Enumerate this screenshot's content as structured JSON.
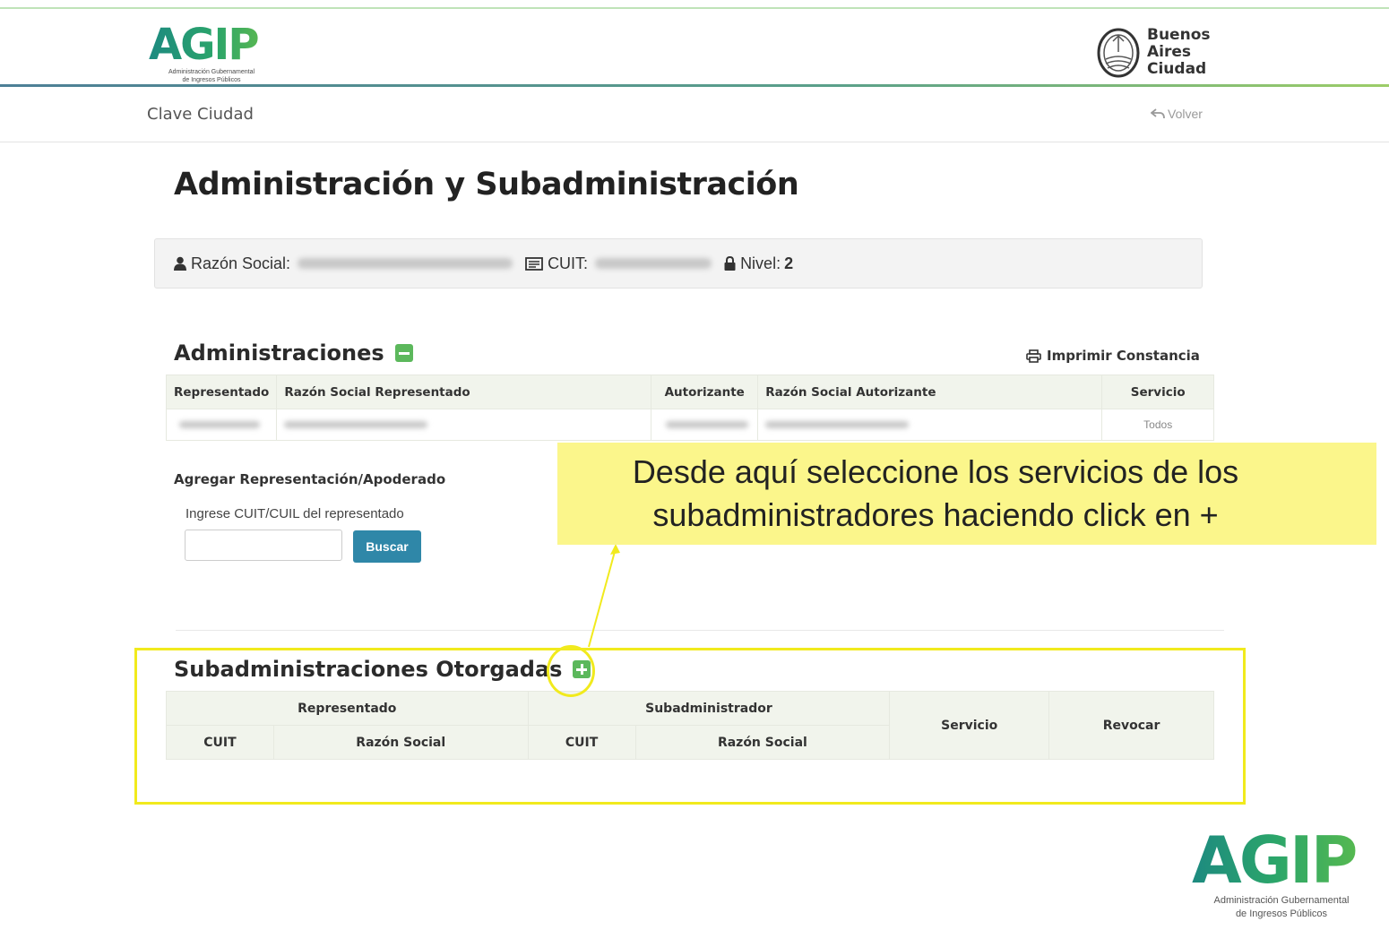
{
  "header": {
    "logo_word": "AGIP",
    "logo_sub_1": "Administración Gubernamental",
    "logo_sub_2": "de Ingresos Públicos",
    "ba_line1": "Buenos",
    "ba_line2": "Aires",
    "ba_line3": "Ciudad"
  },
  "subnav": {
    "title": "Clave Ciudad",
    "back_label": "Volver"
  },
  "page": {
    "title": "Administración y Subadministración"
  },
  "info": {
    "razon_label": "Razón Social:",
    "cuit_label": "CUIT:",
    "nivel_label": "Nivel:",
    "nivel_value": "2"
  },
  "administraciones": {
    "title": "Administraciones",
    "print_label": "Imprimir Constancia",
    "columns": [
      "Representado",
      "Razón Social Representado",
      "Autorizante",
      "Razón Social Autorizante",
      "Servicio"
    ],
    "rows": [
      {
        "servicio": "Todos"
      }
    ]
  },
  "agregar": {
    "title": "Agregar Representación/Apoderado",
    "field_label": "Ingrese CUIT/CUIL del representado",
    "input_value": "",
    "button_label": "Buscar"
  },
  "subadministraciones": {
    "title": "Subadministraciones Otorgadas",
    "group_representado": "Representado",
    "group_subadministrador": "Subadministrador",
    "col_servicio": "Servicio",
    "col_revocar": "Revocar",
    "sub_cuit_1": "CUIT",
    "sub_razon_1": "Razón Social",
    "sub_cuit_2": "CUIT",
    "sub_razon_2": "Razón Social"
  },
  "annotation": {
    "line1": "Desde aquí seleccione los servicios de los",
    "line2": "subadministradores haciendo click en +",
    "highlight_color": "#f1ea1d",
    "callout_color": "#fbf68b"
  },
  "footer": {
    "logo_word": "AGIP",
    "sub_1": "Administración Gubernamental",
    "sub_2": "de Ingresos Públicos"
  },
  "colors": {
    "accent_green": "#5cb85c",
    "button_blue": "#2f87a8",
    "table_header_bg": "#f1f4ec"
  }
}
